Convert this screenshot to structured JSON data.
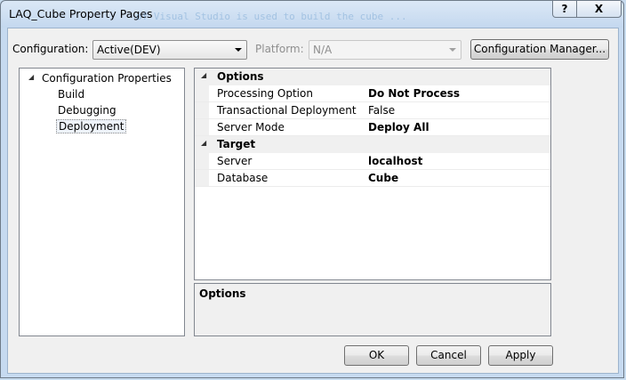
{
  "window": {
    "title": "LAQ_Cube Property Pages",
    "ghost_text": "of Visual Studio is used to build the cube ...",
    "help_label": "?",
    "close_label": "X"
  },
  "toolbar": {
    "configuration_label": "Configuration:",
    "configuration_value": "Active(DEV)",
    "platform_label": "Platform:",
    "platform_value": "N/A",
    "config_manager_label": "Configuration Manager..."
  },
  "tree": {
    "root": "Configuration Properties",
    "children": [
      "Build",
      "Debugging",
      "Deployment"
    ],
    "selected": "Deployment"
  },
  "grid": {
    "categories": [
      {
        "name": "Options",
        "properties": [
          {
            "name": "Processing Option",
            "value": "Do Not Process",
            "bold": true
          },
          {
            "name": "Transactional Deployment",
            "value": "False",
            "bold": false
          },
          {
            "name": "Server Mode",
            "value": "Deploy All",
            "bold": true
          }
        ]
      },
      {
        "name": "Target",
        "properties": [
          {
            "name": "Server",
            "value": "localhost",
            "bold": true
          },
          {
            "name": "Database",
            "value": "Cube",
            "bold": true
          }
        ]
      }
    ]
  },
  "description": {
    "title": "Options"
  },
  "buttons": {
    "ok": "OK",
    "cancel": "Cancel",
    "apply": "Apply"
  },
  "colors": {
    "window_frame": "#c6daf0",
    "client_bg": "#f0f0f0",
    "selection_border": "#888888"
  }
}
